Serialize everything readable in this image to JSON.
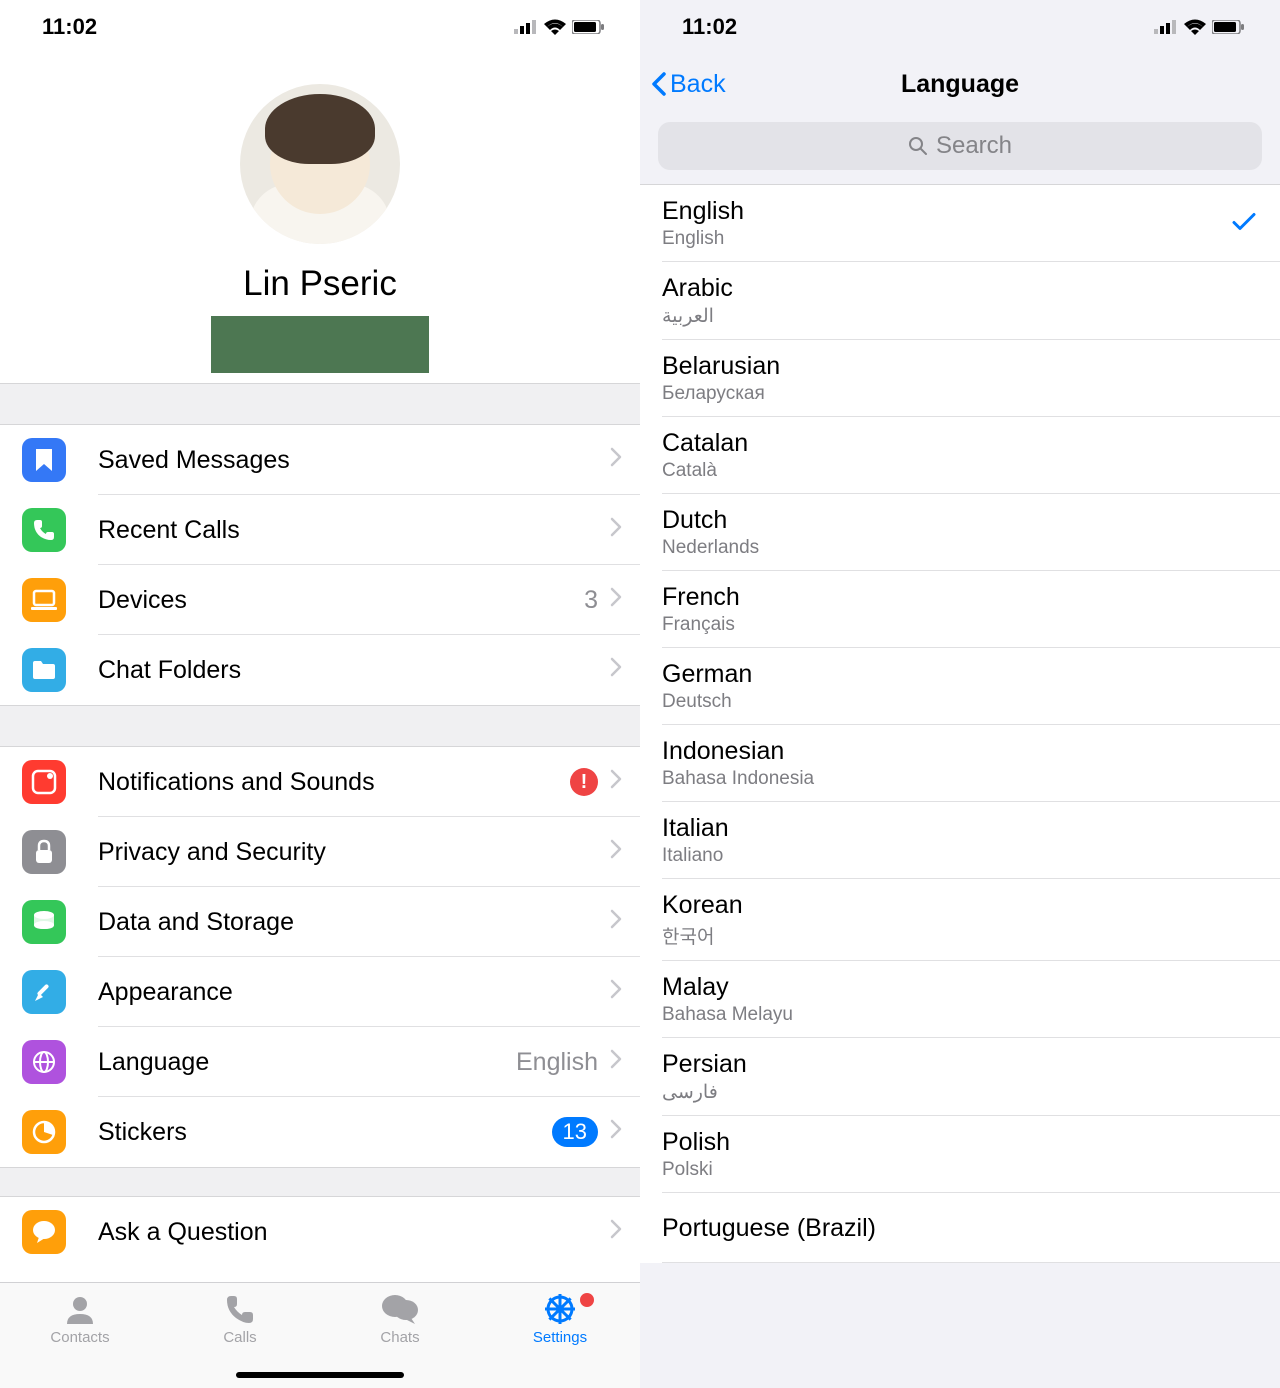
{
  "status": {
    "time": "11:02"
  },
  "profile": {
    "name": "Lin Pseric"
  },
  "groups": [
    [
      {
        "icon": "bookmark",
        "color": "#3478f6",
        "label": "Saved Messages"
      },
      {
        "icon": "phone",
        "color": "#34c759",
        "label": "Recent Calls"
      },
      {
        "icon": "laptop",
        "color": "#ff9f0a",
        "label": "Devices",
        "value": "3"
      },
      {
        "icon": "folder",
        "color": "#32ade6",
        "label": "Chat Folders"
      }
    ],
    [
      {
        "icon": "bell",
        "color": "#ff3b30",
        "label": "Notifications and Sounds",
        "alert": "!"
      },
      {
        "icon": "lock",
        "color": "#8e8e93",
        "label": "Privacy and Security"
      },
      {
        "icon": "disk",
        "color": "#34c759",
        "label": "Data and Storage"
      },
      {
        "icon": "brush",
        "color": "#32ade6",
        "label": "Appearance"
      },
      {
        "icon": "globe",
        "color": "#af52de",
        "label": "Language",
        "value": "English"
      },
      {
        "icon": "pie",
        "color": "#ff9f0a",
        "label": "Stickers",
        "badge": "13"
      }
    ],
    [
      {
        "icon": "chat",
        "color": "#ff9f0a",
        "label": "Ask a Question"
      }
    ]
  ],
  "tabs": [
    {
      "key": "contacts",
      "label": "Contacts"
    },
    {
      "key": "calls",
      "label": "Calls"
    },
    {
      "key": "chats",
      "label": "Chats"
    },
    {
      "key": "settings",
      "label": "Settings",
      "active": true,
      "alert": true
    }
  ],
  "lang_screen": {
    "back": "Back",
    "title": "Language",
    "search_placeholder": "Search",
    "items": [
      {
        "name": "English",
        "native": "English",
        "selected": true
      },
      {
        "name": "Arabic",
        "native": "العربية"
      },
      {
        "name": "Belarusian",
        "native": "Беларуская"
      },
      {
        "name": "Catalan",
        "native": "Català"
      },
      {
        "name": "Dutch",
        "native": "Nederlands"
      },
      {
        "name": "French",
        "native": "Français"
      },
      {
        "name": "German",
        "native": "Deutsch"
      },
      {
        "name": "Indonesian",
        "native": "Bahasa Indonesia"
      },
      {
        "name": "Italian",
        "native": "Italiano"
      },
      {
        "name": "Korean",
        "native": "한국어"
      },
      {
        "name": "Malay",
        "native": "Bahasa Melayu"
      },
      {
        "name": "Persian",
        "native": "فارسی"
      },
      {
        "name": "Polish",
        "native": "Polski"
      },
      {
        "name": "Portuguese (Brazil)",
        "native": ""
      }
    ]
  }
}
